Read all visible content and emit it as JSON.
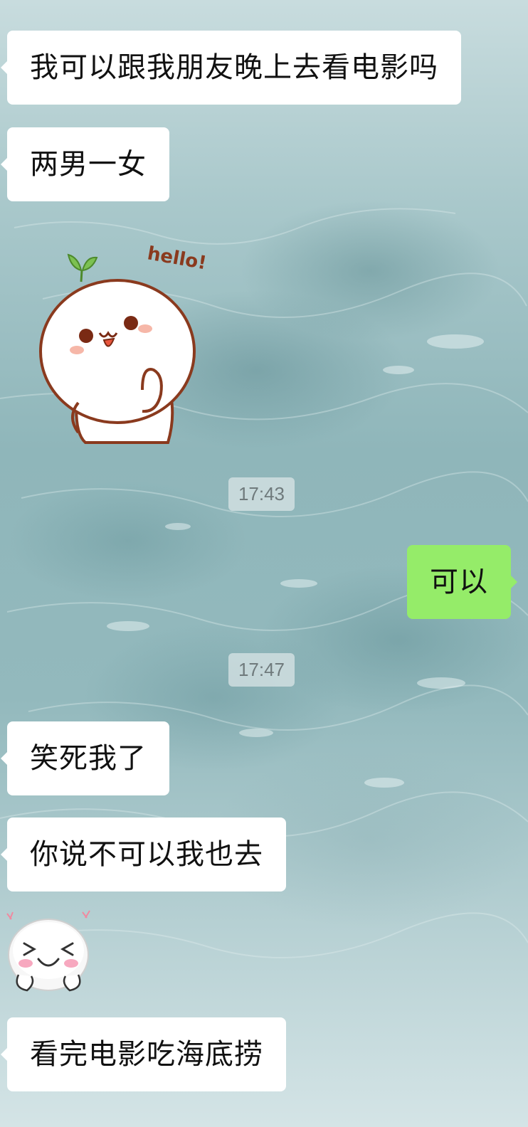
{
  "background": {
    "theme": "water-ripple",
    "colors": [
      "#c8dcde",
      "#8fb6ba",
      "#d4e4e6"
    ]
  },
  "bubble_colors": {
    "incoming": "#ffffff",
    "outgoing": "#95ec69"
  },
  "messages": [
    {
      "side": "left",
      "type": "text",
      "text": "我可以跟我朋友晚上去看电影吗"
    },
    {
      "side": "left",
      "type": "text",
      "text": "两男一女"
    },
    {
      "side": "left",
      "type": "sticker",
      "sticker": "hello-sprout-sticker",
      "sticker_text": "hello!"
    },
    {
      "type": "timestamp",
      "text": "17:43"
    },
    {
      "side": "right",
      "type": "text",
      "text": "可以"
    },
    {
      "type": "timestamp",
      "text": "17:47"
    },
    {
      "side": "left",
      "type": "text",
      "text": "笑死我了"
    },
    {
      "side": "left",
      "type": "text",
      "text": "你说不可以我也去"
    },
    {
      "side": "left",
      "type": "sticker",
      "sticker": "laughing-face-sticker"
    },
    {
      "side": "left",
      "type": "text",
      "text": "看完电影吃海底捞"
    }
  ]
}
